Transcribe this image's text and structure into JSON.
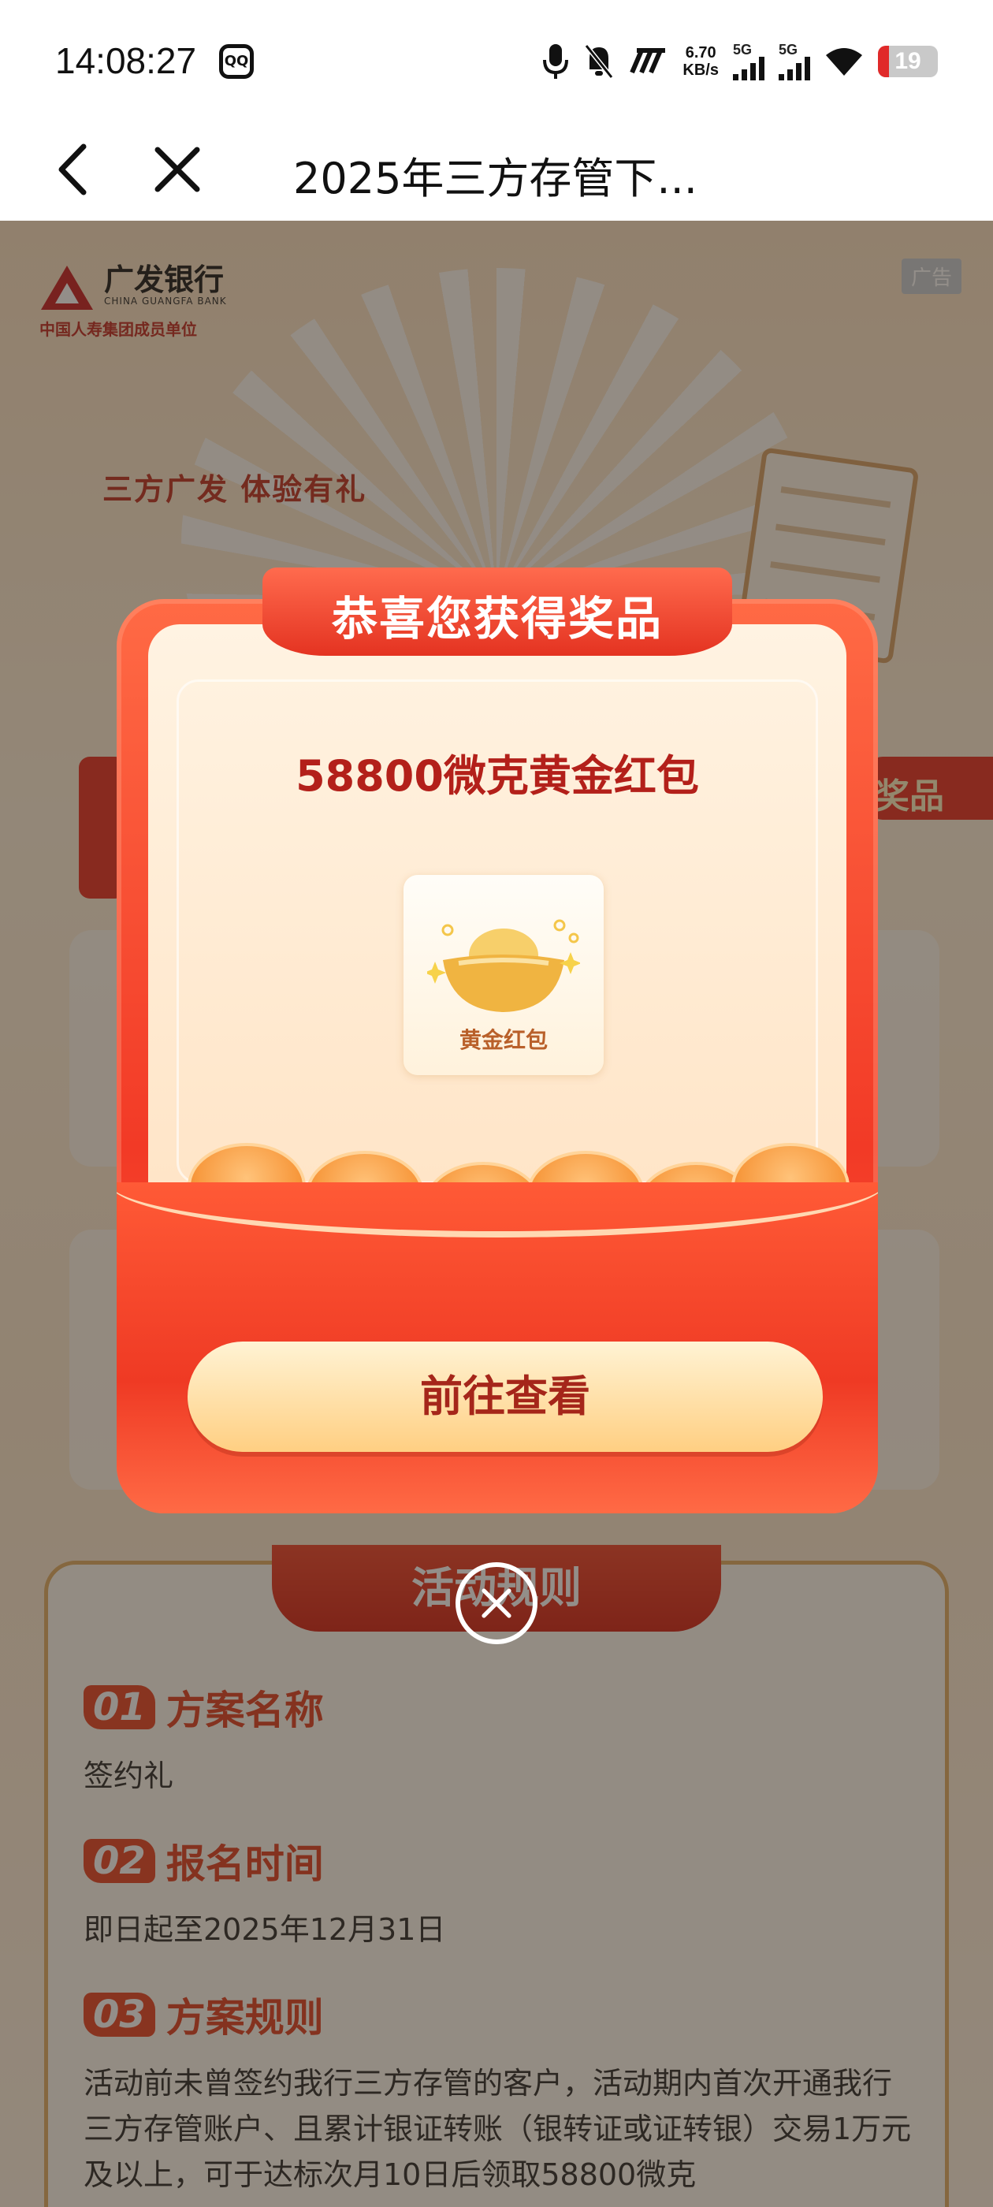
{
  "status_bar": {
    "time": "14:08:27",
    "app_badge": "QQ",
    "net_speed_value": "6.70",
    "net_speed_unit": "KB/s",
    "sim1": "5G",
    "sim2": "5G",
    "battery": "19",
    "battery_level": 0.19,
    "icons": [
      "mic-icon",
      "mute-bell-icon",
      "hd-icon",
      "signal-icon",
      "wifi-icon",
      "battery-icon"
    ]
  },
  "nav": {
    "title": "2025年三方存管下..."
  },
  "background_page": {
    "bank_name": "广发银行",
    "bank_name_en": "CHINA GUANGFA BANK",
    "bank_sub": "中国人寿集团成员单位",
    "ad_tag": "广告",
    "slogan": "三方广发 体验有礼",
    "banner_fragment": "奖品",
    "rules_heading": "活动规则",
    "rules": [
      {
        "num": "01",
        "title": "方案名称",
        "body": "签约礼"
      },
      {
        "num": "02",
        "title": "报名时间",
        "body": "即日起至2025年12月31日"
      },
      {
        "num": "03",
        "title": "方案规则",
        "body": "活动前未曾签约我行三方存管的客户，活动期内首次开通我行三方存管账户、且累计银证转账（银转证或证转银）交易1万元及以上，可于达标次月10日后领取58800微克"
      }
    ]
  },
  "modal": {
    "ribbon_text": "恭喜您获得奖品",
    "prize_title": "58800微克黄金红包",
    "prize_label": "黄金红包",
    "cta_label": "前往查看"
  },
  "colors": {
    "accent_red": "#f23a26",
    "cta_text": "#a5261a",
    "prize_title": "#b3201a"
  }
}
